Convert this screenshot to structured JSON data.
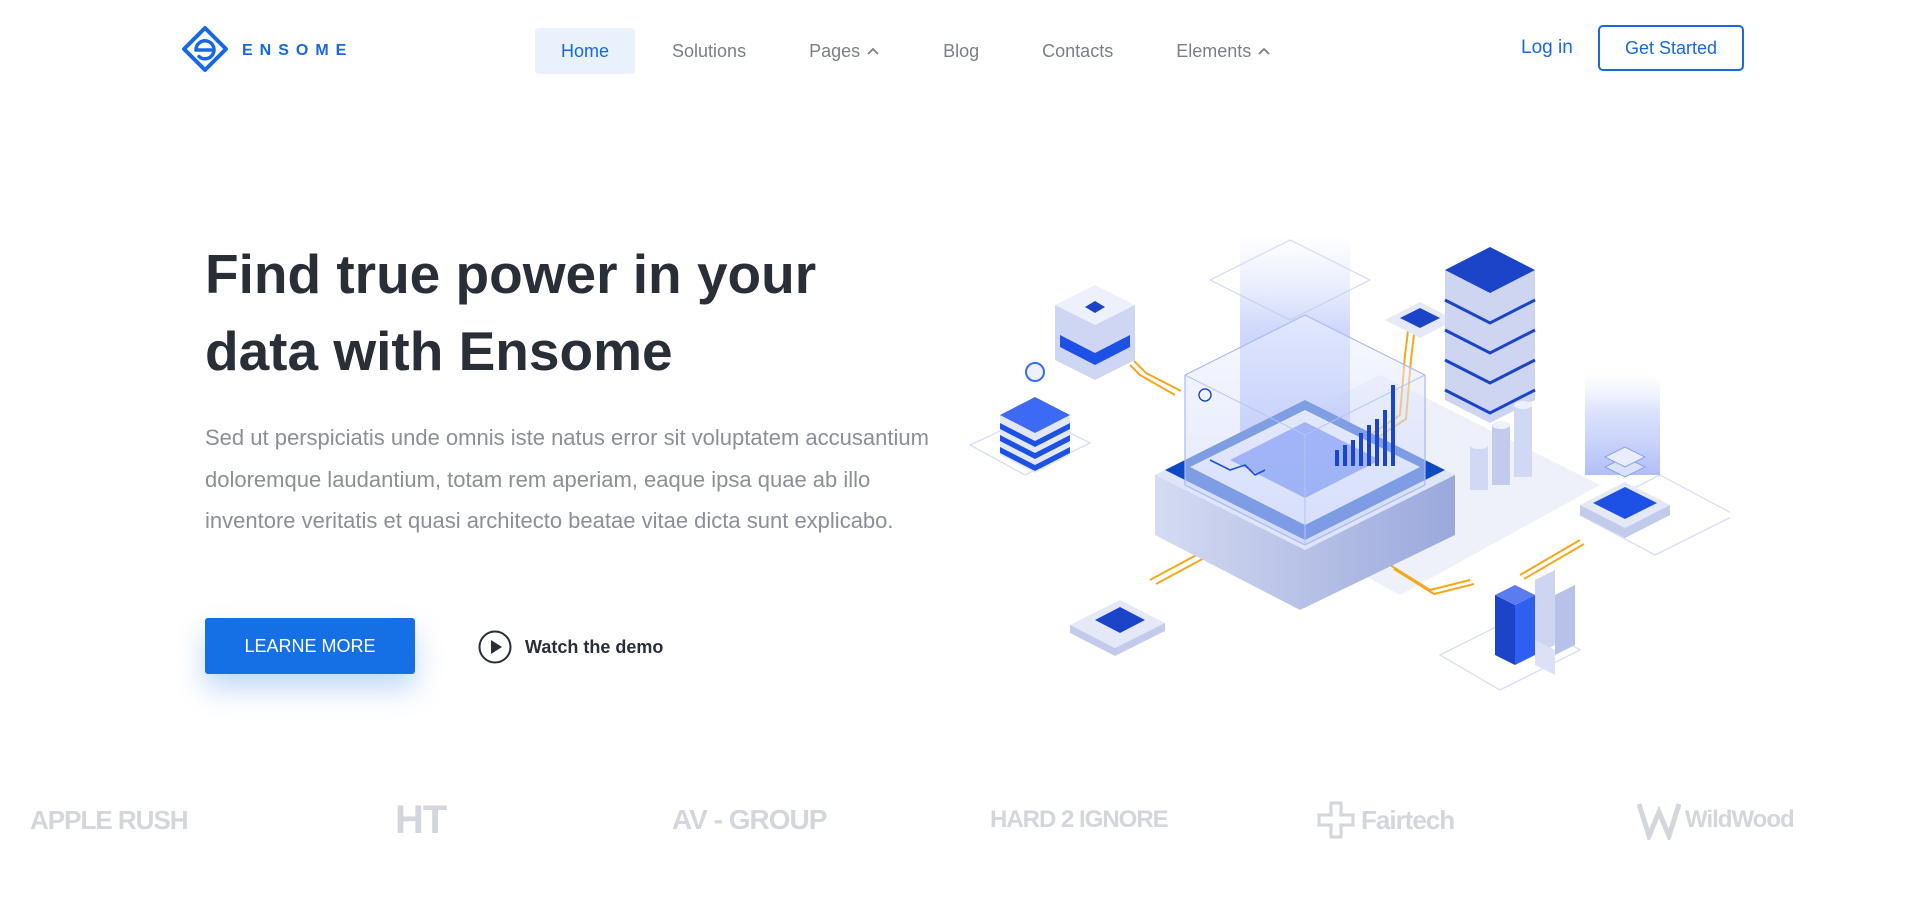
{
  "brand": {
    "name": "ENSOME",
    "accent": "#1768e4",
    "button_blue": "#1570e6"
  },
  "nav": {
    "items": [
      {
        "label": "Home",
        "active": true,
        "dropdown": false
      },
      {
        "label": "Solutions",
        "active": false,
        "dropdown": false
      },
      {
        "label": "Pages",
        "active": false,
        "dropdown": true
      },
      {
        "label": "Blog",
        "active": false,
        "dropdown": false
      },
      {
        "label": "Contacts",
        "active": false,
        "dropdown": false
      },
      {
        "label": "Elements",
        "active": false,
        "dropdown": true
      }
    ],
    "login_label": "Log in",
    "cta_label": "Get Started"
  },
  "hero": {
    "title_line1": "Find true power in your",
    "title_line2": "data with Ensome",
    "description": "Sed ut perspiciatis unde omnis iste natus error sit voluptatem accusantium doloremque laudantium, totam rem aperiam, eaque ipsa quae ab illo inventore veritatis et quasi architecto beatae vitae dicta sunt explicabo.",
    "primary_button": "LEARNE MORE",
    "demo_label": "Watch the demo",
    "demo_icon": "play-circle-icon"
  },
  "partners": [
    {
      "name": "APPLE RUSH"
    },
    {
      "name": "HT"
    },
    {
      "name": "AV - GROUP"
    },
    {
      "name": "HARD 2 IGNORE"
    },
    {
      "name": "Fairtech"
    },
    {
      "name": "WildWood"
    }
  ]
}
